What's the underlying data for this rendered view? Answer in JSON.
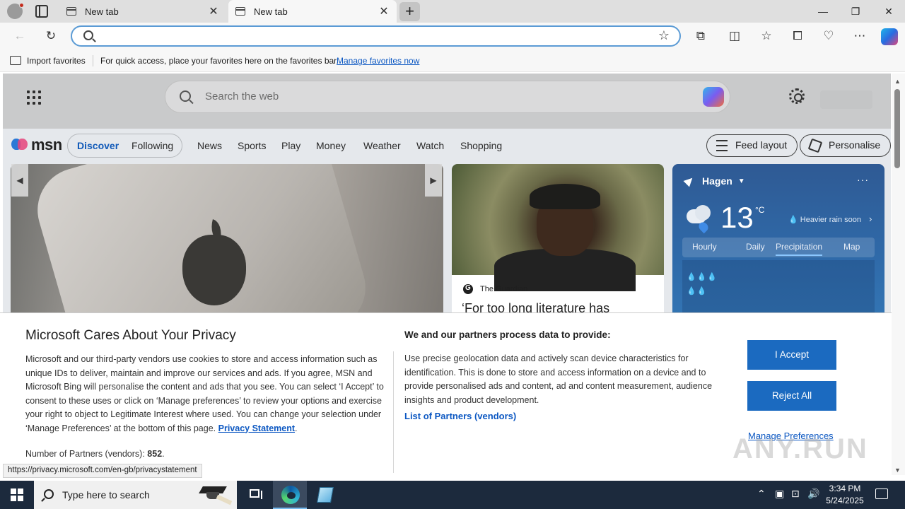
{
  "browser": {
    "tabs": [
      {
        "label": "New tab",
        "active": false
      },
      {
        "label": "New tab",
        "active": true
      }
    ],
    "address_value": "",
    "favorites_bar": {
      "import_label": "Import favorites",
      "info_text": "For quick access, place your favorites here on the favorites bar.",
      "manage_link": "Manage favorites now"
    }
  },
  "msn": {
    "search_placeholder": "Search the web",
    "logo_text": "msn",
    "feed_tabs": [
      "Discover",
      "Following"
    ],
    "nav_links": [
      "News",
      "Sports",
      "Play",
      "Money",
      "Weather",
      "Watch",
      "Shopping"
    ],
    "feed_layout_label": "Feed layout",
    "personalise_label": "Personalise",
    "news_card": {
      "source": "The Guardian",
      "headline": "‘For too long literature has"
    },
    "weather": {
      "city": "Hagen",
      "temperature": "13",
      "unit": "°C",
      "note": "Heavier rain soon",
      "tabs": [
        "Hourly",
        "Daily",
        "Precipitation",
        "Map"
      ],
      "active_tab": "Precipitation"
    }
  },
  "privacy": {
    "title": "Microsoft Cares About Your Privacy",
    "body": "Microsoft and our third-party vendors use cookies to store and access information such as unique IDs to deliver, maintain and improve our services and ads. If you agree, MSN and Microsoft Bing will personalise the content and ads that you see. You can select ‘I Accept’ to consent to these uses or click on ‘Manage preferences’ to review your options and exercise your right to object to Legitimate Interest where used.  You can change your selection under ‘Manage Preferences’ at the bottom of this page.",
    "privacy_link": "Privacy Statement",
    "partners_label": "Number of Partners (vendors):",
    "partners_count": "852",
    "right_title": "We and our partners process data to provide:",
    "right_body": "Use precise geolocation data and actively scan device characteristics for identification. This is done to store and access information on a device and to provide personalised ads and content, ad and content measurement, audience insights and product development.",
    "partners_link": "List of Partners (vendors)",
    "accept_label": "I Accept",
    "reject_label": "Reject All",
    "manage_label": "Manage Preferences"
  },
  "status_url": "https://privacy.microsoft.com/en-gb/privacystatement",
  "watermark": "ANY.RUN",
  "taskbar": {
    "search_placeholder": "Type here to search",
    "time": "3:34 PM",
    "date": "5/24/2025"
  },
  "colors": {
    "accent": "#1b6ac0",
    "link": "#0b57c2",
    "taskbar": "#1c2a3d",
    "weather_card": "#2f6aa9"
  }
}
